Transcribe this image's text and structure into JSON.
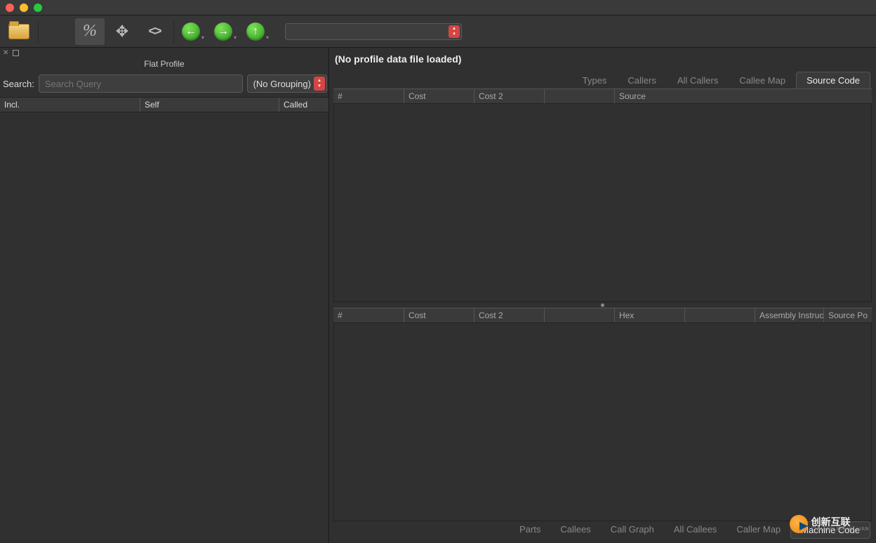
{
  "titlebar": {},
  "toolbar": {
    "icons": {
      "open": "folder-icon",
      "refresh": "refresh-icon",
      "percent": "%",
      "move": "move-icon",
      "code": "<>"
    }
  },
  "left": {
    "title": "Flat Profile",
    "search_label": "Search:",
    "search_placeholder": "Search Query",
    "grouping_label": "(No Grouping)",
    "columns": [
      "Incl.",
      "Self",
      "Called"
    ]
  },
  "right": {
    "status": "(No profile data file loaded)",
    "top_tabs": [
      "Types",
      "Callers",
      "All Callers",
      "Callee Map",
      "Source Code"
    ],
    "top_active": "Source Code",
    "src_columns": [
      "#",
      "Cost",
      "Cost 2",
      "",
      "Source"
    ],
    "asm_columns": [
      "#",
      "Cost",
      "Cost 2",
      "",
      "Hex",
      "",
      "Assembly Instruct",
      "Source Po"
    ],
    "bottom_tabs": [
      "Parts",
      "Callees",
      "Call Graph",
      "All Callees",
      "Caller Map",
      "Machine Code"
    ],
    "bottom_active": "Machine Code"
  },
  "watermark": {
    "top": "创新互联",
    "bot": "CHUANG XIN HU LIAN"
  }
}
